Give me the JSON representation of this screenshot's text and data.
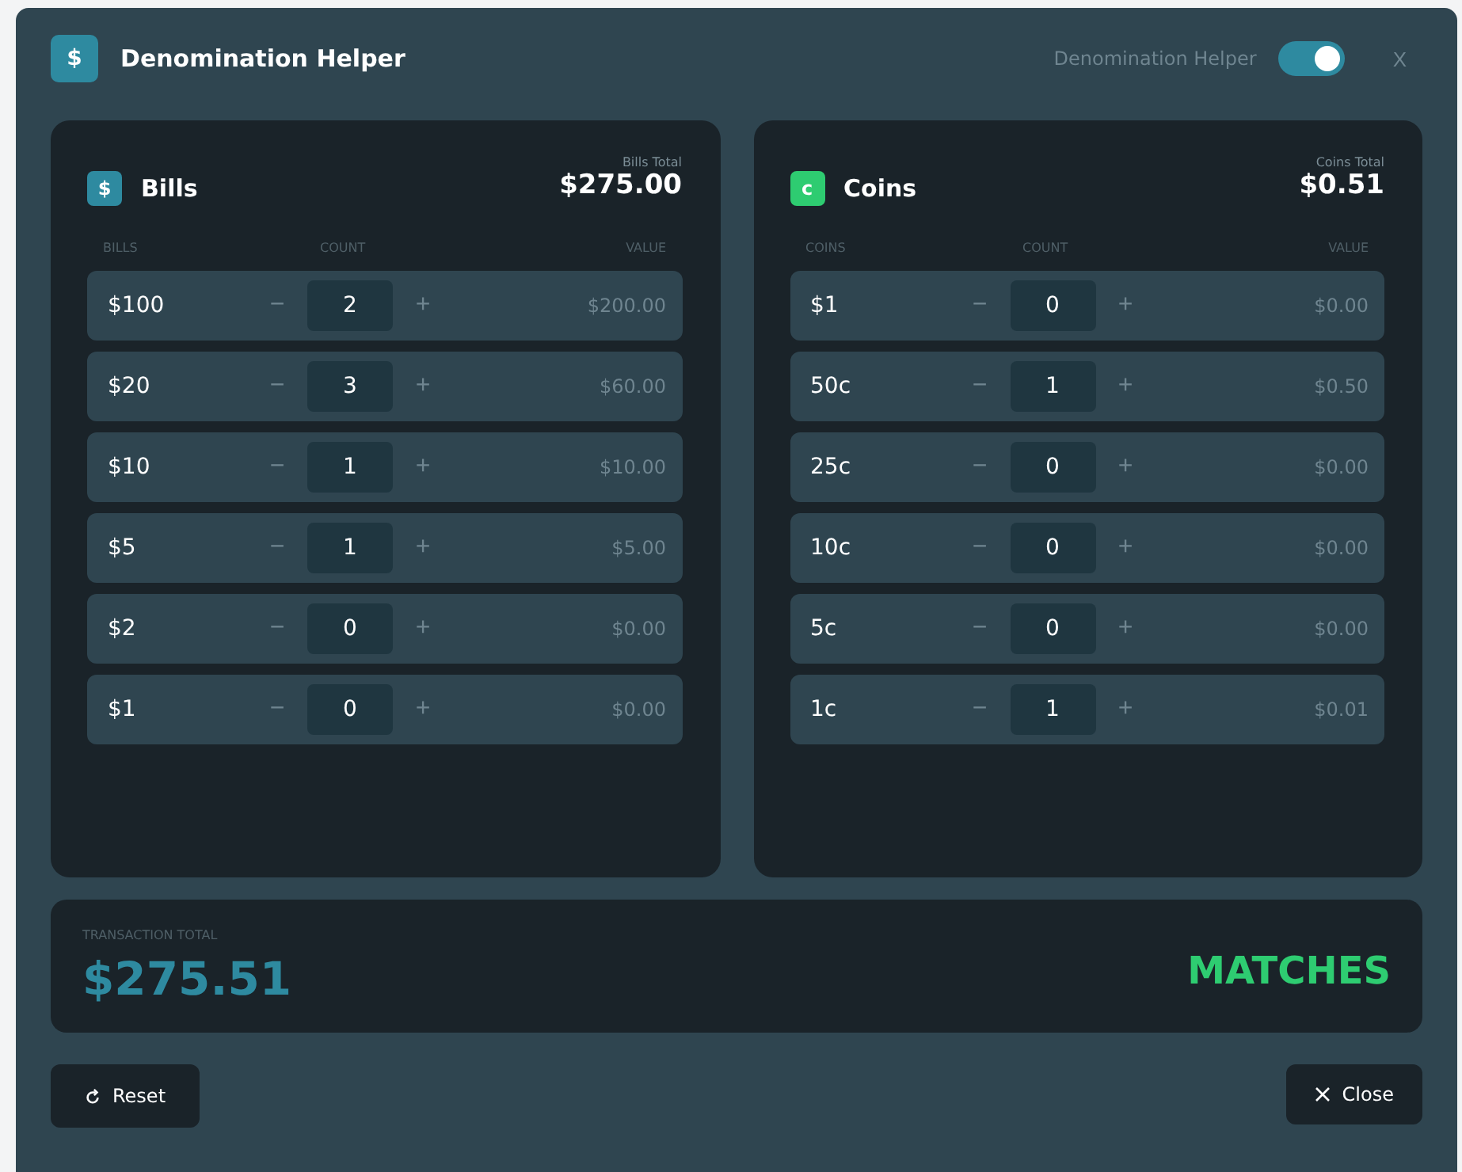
{
  "window": {
    "title": "Denomination Helper",
    "icon": "$",
    "toggle": {
      "label": "Denomination Helper",
      "on": true
    },
    "close": "X"
  },
  "panels": [
    {
      "kind": "bills",
      "icon": "$",
      "title": "Bills",
      "total_label": "Bills Total",
      "total": "$275.00",
      "columns": [
        "BILLS",
        "COUNT",
        "VALUE"
      ],
      "rows": [
        {
          "name": "$100",
          "minus": "−",
          "count": "2",
          "plus": "+",
          "value": "$200.00"
        },
        {
          "name": "$20",
          "minus": "−",
          "count": "3",
          "plus": "+",
          "value": "$60.00"
        },
        {
          "name": "$10",
          "minus": "−",
          "count": "1",
          "plus": "+",
          "value": "$10.00"
        },
        {
          "name": "$5",
          "minus": "−",
          "count": "1",
          "plus": "+",
          "value": "$5.00"
        },
        {
          "name": "$2",
          "minus": "−",
          "count": "0",
          "plus": "+",
          "value": "$0.00"
        },
        {
          "name": "$1",
          "minus": "−",
          "count": "0",
          "plus": "+",
          "value": "$0.00"
        }
      ]
    },
    {
      "kind": "coins",
      "icon": "c",
      "title": "Coins",
      "total_label": "Coins Total",
      "total": "$0.51",
      "columns": [
        "COINS",
        "COUNT",
        "VALUE"
      ],
      "rows": [
        {
          "name": "$1",
          "minus": "−",
          "count": "0",
          "plus": "+",
          "value": "$0.00"
        },
        {
          "name": "50c",
          "minus": "−",
          "count": "1",
          "plus": "+",
          "value": "$0.50"
        },
        {
          "name": "25c",
          "minus": "−",
          "count": "0",
          "plus": "+",
          "value": "$0.00"
        },
        {
          "name": "10c",
          "minus": "−",
          "count": "0",
          "plus": "+",
          "value": "$0.00"
        },
        {
          "name": "5c",
          "minus": "−",
          "count": "0",
          "plus": "+",
          "value": "$0.00"
        },
        {
          "name": "1c",
          "minus": "−",
          "count": "1",
          "plus": "+",
          "value": "$0.01"
        }
      ]
    }
  ],
  "transaction": {
    "label": "TRANSACTION TOTAL",
    "total": "$275.51",
    "status": "MATCHES"
  },
  "buttons": [
    {
      "kind": "reset",
      "label": "Reset"
    },
    {
      "kind": "close",
      "label": "Close"
    }
  ]
}
